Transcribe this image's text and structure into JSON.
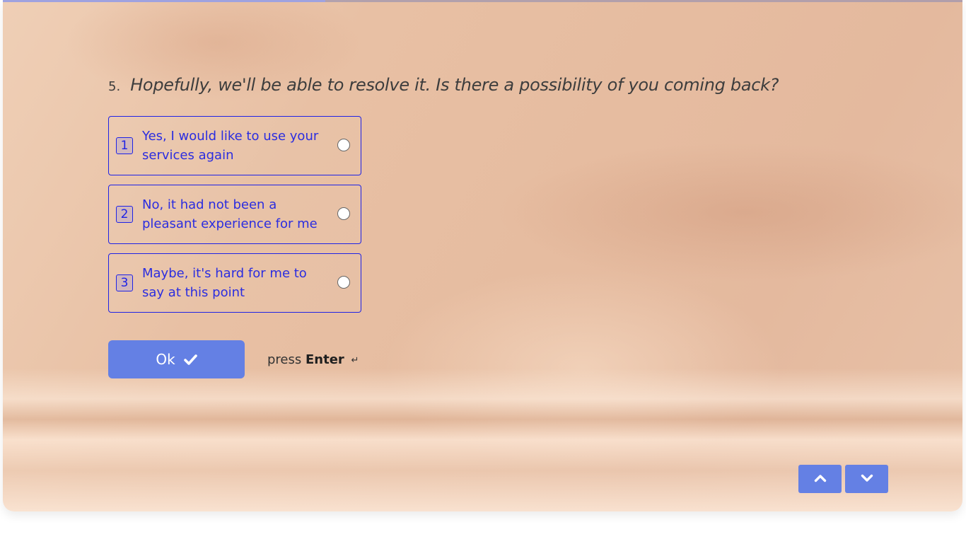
{
  "progress": {
    "fraction": 0.336,
    "fill_color": "#9fa2df"
  },
  "question": {
    "number": "5.",
    "text": "Hopefully, we'll be able to resolve it. Is there a possibility of you coming back?"
  },
  "options": [
    {
      "key": "1",
      "label": "Yes, I would like to use your services again",
      "selected": false
    },
    {
      "key": "2",
      "label": "No, it had not been a pleasant experience for me",
      "selected": false
    },
    {
      "key": "3",
      "label": "Maybe, it's hard for me to say at this point",
      "selected": false
    }
  ],
  "actions": {
    "ok_label": "Ok",
    "hint_prefix": "press",
    "hint_key": "Enter",
    "hint_icon": "↵"
  },
  "navigation": {
    "up_icon": "chevron-up-icon",
    "down_icon": "chevron-down-icon"
  },
  "colors": {
    "accent": "#6480e4",
    "option_text": "#2b2de0",
    "option_border": "#1e22e6",
    "question_text": "#3d3d3d"
  }
}
